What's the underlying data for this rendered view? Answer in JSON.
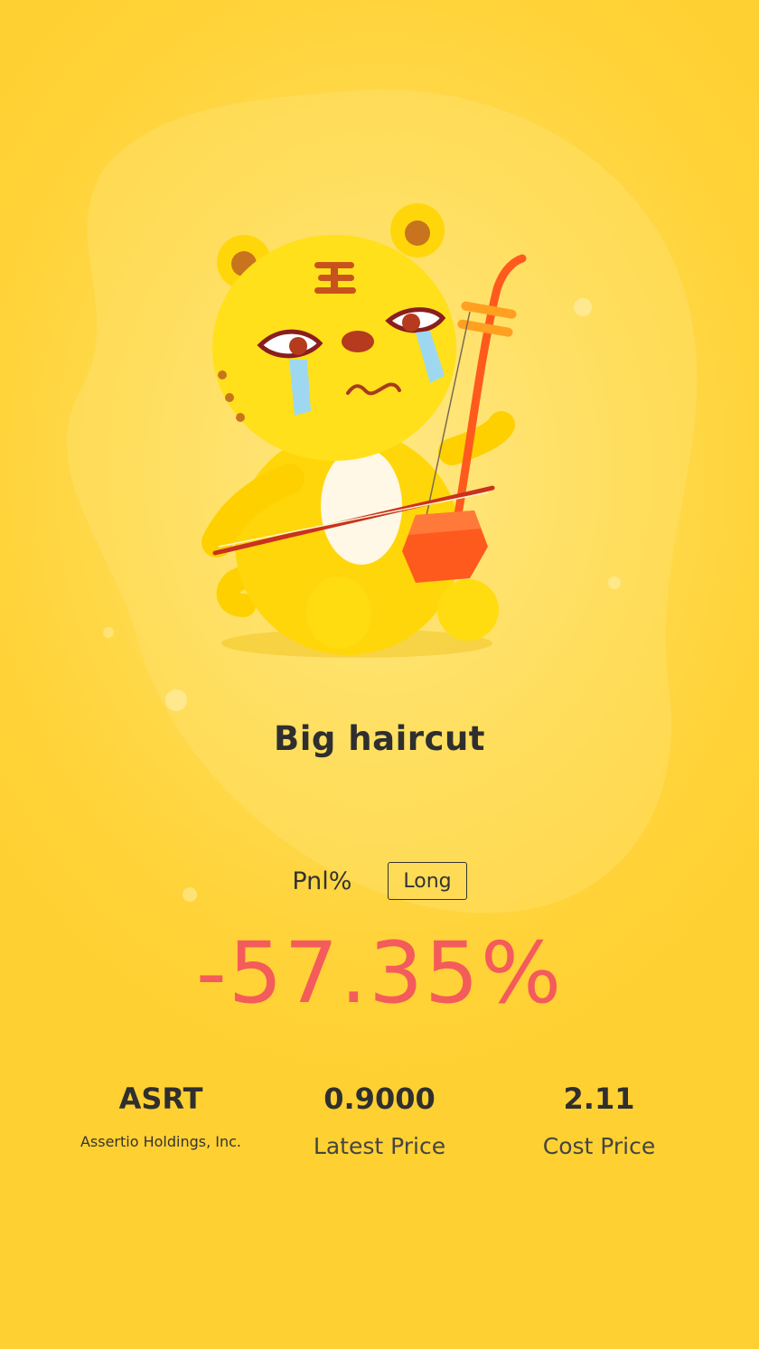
{
  "result": {
    "headline": "Big haircut"
  },
  "pnl": {
    "label": "Pnl%",
    "side": "Long",
    "value": "-57.35%"
  },
  "stats": {
    "ticker": "ASRT",
    "company": "Assertio Holdings, Inc.",
    "latest_price": "0.9000",
    "latest_price_label": "Latest Price",
    "cost_price": "2.11",
    "cost_price_label": "Cost Price"
  },
  "colors": {
    "background": "#ffd43c",
    "loss": "#f45b5b",
    "text": "#333333"
  },
  "icons": {
    "mascot": "crying-tiger-playing-erhu"
  }
}
